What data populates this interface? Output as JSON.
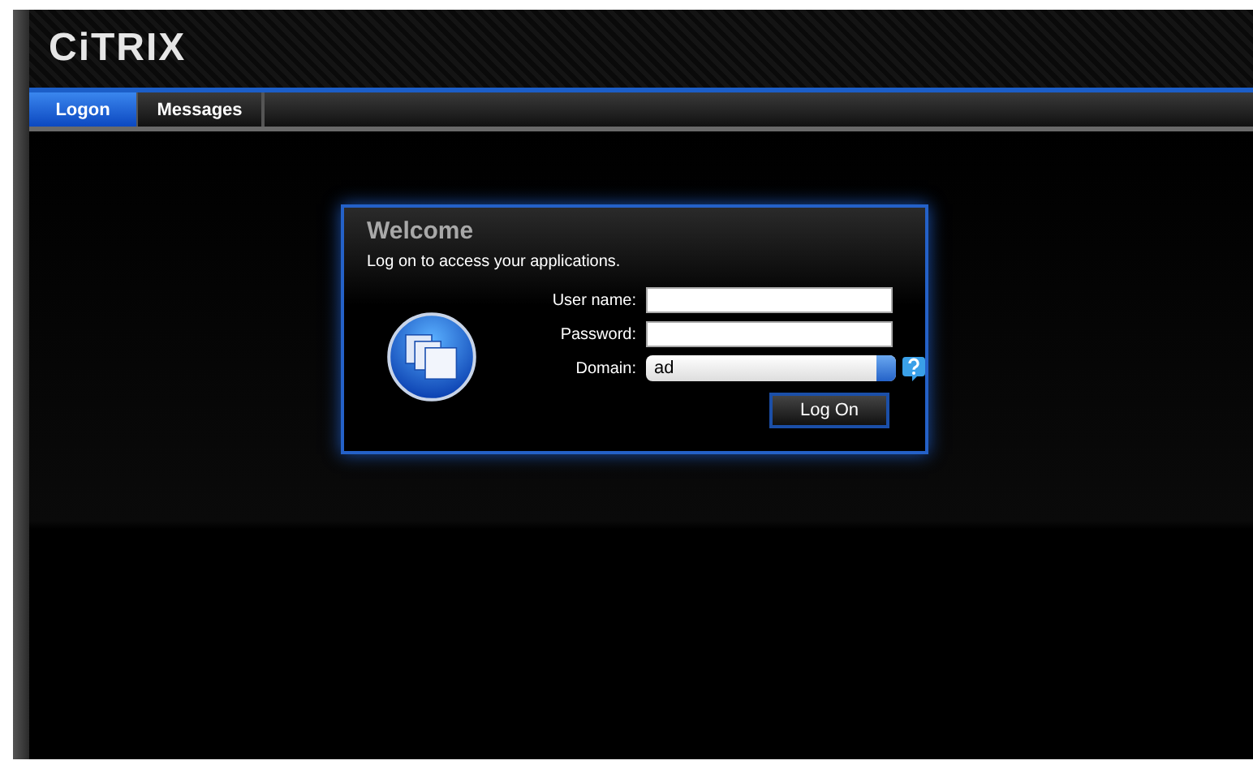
{
  "logo": "CiTRIX",
  "tabs": [
    {
      "label": "Logon",
      "selected": true
    },
    {
      "label": "Messages",
      "selected": false
    }
  ],
  "dialog": {
    "title": "Welcome",
    "subtitle": "Log on to access your applications.",
    "fields": [
      {
        "label": "User name:",
        "kind": "text"
      },
      {
        "label": "Password:",
        "kind": "password"
      },
      {
        "label": "Domain:",
        "kind": "select",
        "value": "ad"
      }
    ],
    "button": "Log On"
  }
}
